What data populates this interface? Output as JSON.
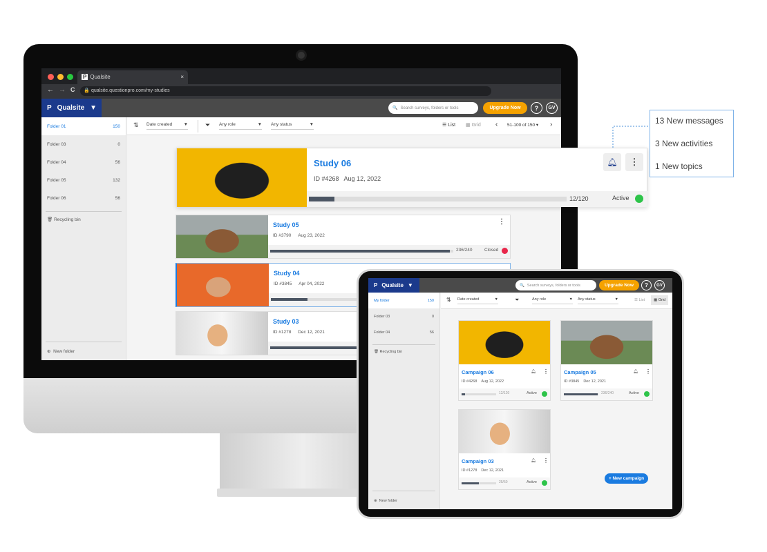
{
  "browser": {
    "tab_title": "Qualsite",
    "tab_close": "×",
    "url": "qualsite.questionpro.com/my-studies",
    "nav": [
      "←",
      "→",
      "C"
    ],
    "traffic_colors": [
      "#ff5f57",
      "#febc2e",
      "#28c840"
    ]
  },
  "app": {
    "brand": "Qualsite",
    "logo": "P",
    "search_placeholder": "Search surveys, folders or tools",
    "upgrade": "Upgrade Now",
    "help": "?",
    "avatar": "GV",
    "brand_color": "#1b3a8c",
    "accent": "#f5a200"
  },
  "desktop": {
    "folders": [
      {
        "name": "Folder 01",
        "count": "150",
        "active": true
      },
      {
        "name": "Folder 03",
        "count": "0"
      },
      {
        "name": "Folder 04",
        "count": "56"
      },
      {
        "name": "Folder 05",
        "count": "132"
      },
      {
        "name": "Folder 06",
        "count": "56"
      }
    ],
    "recycling": "Recycling bin",
    "new_folder": "New folder",
    "toolbar": {
      "sort": "Date created",
      "role": "Any role",
      "status": "Any status",
      "list": "List",
      "grid": "Grid",
      "pagination": "51-100 of 150"
    },
    "studies": [
      {
        "title": "Study 06",
        "id": "ID #4268",
        "date": "Aug 12, 2022",
        "progress": "12/120",
        "fraction": 0.1,
        "status": "Active",
        "status_color": "#2ec44a",
        "photo": "pug"
      },
      {
        "title": "Study 05",
        "id": "ID #3790",
        "date": "Aug 23, 2022",
        "progress": "236/240",
        "fraction": 0.98,
        "status": "Closed",
        "status_color": "#e8264a",
        "photo": "cow"
      },
      {
        "title": "Study 04",
        "id": "ID #3845",
        "date": "Apr 04, 2022",
        "fraction": 0.2,
        "photo": "corgi"
      },
      {
        "title": "Study 03",
        "id": "ID #1278",
        "date": "Dec 12, 2021",
        "fraction": 0.9,
        "photo": "hamster"
      }
    ]
  },
  "notifications": [
    "13 New messages",
    "3 New activities",
    "1 New topics"
  ],
  "tablet": {
    "folders": [
      {
        "name": "My folder",
        "count": "150",
        "active": true
      },
      {
        "name": "Folder 03",
        "count": "0"
      },
      {
        "name": "Folder 04",
        "count": "56"
      }
    ],
    "recycling": "Recycling bin",
    "new_folder": "New folder",
    "toolbar": {
      "sort": "Date created",
      "role": "Any role",
      "status": "Any status",
      "list": "List",
      "grid": "Grid"
    },
    "campaigns": [
      {
        "title": "Campaign 06",
        "id": "ID #4268",
        "date": "Aug 12, 2022",
        "progress": "12/120",
        "fraction": 0.1,
        "status": "Active",
        "photo": "pug"
      },
      {
        "title": "Campaign 05",
        "id": "ID #3845",
        "date": "Dec 12, 2021",
        "progress": "236/240",
        "fraction": 0.98,
        "status": "Active",
        "photo": "cow"
      },
      {
        "title": "Campaign 03",
        "id": "ID #1278",
        "date": "Dec 12, 2021",
        "progress": "25/50",
        "fraction": 0.5,
        "status": "Active",
        "photo": "hamster"
      }
    ],
    "new_campaign": "New campaign"
  }
}
